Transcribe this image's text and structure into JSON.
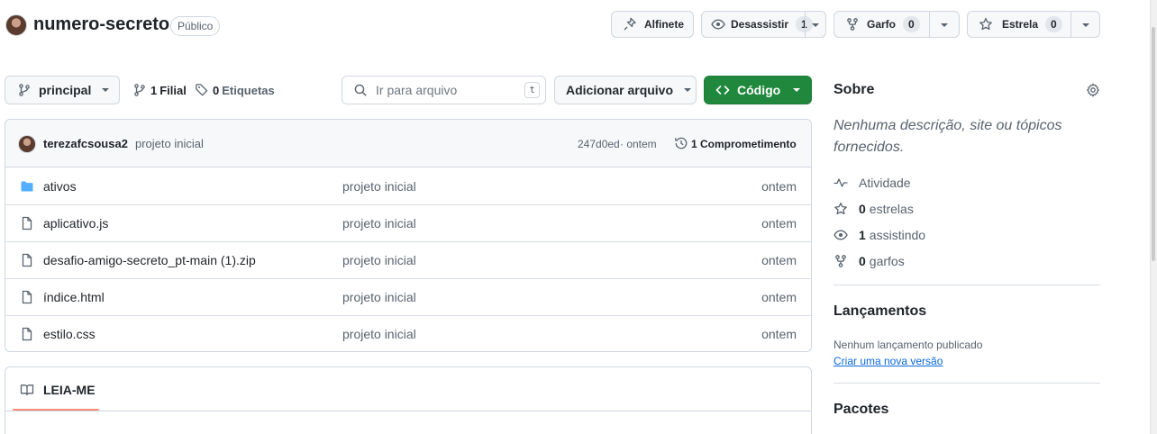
{
  "repo": {
    "name": "numero-secreto",
    "visibility": "Público"
  },
  "actions": {
    "pin": "Alfinete",
    "watch": "Desassistir",
    "watch_count": "1",
    "fork": "Garfo",
    "fork_count": "0",
    "star": "Estrela",
    "star_count": "0"
  },
  "toolbar": {
    "branch": "principal",
    "branches_count": "1",
    "branches_label": "Filial",
    "tags_count": "0",
    "tags_label": "Etiquetas",
    "search_placeholder": "Ir para arquivo",
    "search_shortcut": "t",
    "add_file": "Adicionar arquivo",
    "code": "Código"
  },
  "commit": {
    "author": "terezafcsousa2",
    "message": "projeto inicial",
    "hash": "247d0ed",
    "time": "· ontem",
    "count_label": "1 Comprometimento"
  },
  "files": [
    {
      "name": "ativos",
      "type": "folder",
      "message": "projeto inicial",
      "date": "ontem"
    },
    {
      "name": "aplicativo.js",
      "type": "file",
      "message": "projeto inicial",
      "date": "ontem"
    },
    {
      "name": "desafio-amigo-secreto_pt-main (1).zip",
      "type": "file",
      "message": "projeto inicial",
      "date": "ontem"
    },
    {
      "name": "índice.html",
      "type": "file",
      "message": "projeto inicial",
      "date": "ontem"
    },
    {
      "name": "estilo.css",
      "type": "file",
      "message": "projeto inicial",
      "date": "ontem"
    }
  ],
  "readme": {
    "tab": "LEIA-ME"
  },
  "sidebar": {
    "about_title": "Sobre",
    "description": "Nenhuma descrição, site ou tópicos fornecidos.",
    "activity": "Atividade",
    "stars_count": "0",
    "stars_label": "estrelas",
    "watching_count": "1",
    "watching_label": "assistindo",
    "forks_count": "0",
    "forks_label": "garfos",
    "releases_title": "Lançamentos",
    "releases_empty": "Nenhum lançamento publicado",
    "releases_link": "Criar uma nova versão",
    "packages_title": "Pacotes"
  },
  "colors": {
    "accent_green": "#1f883d",
    "folder_blue": "#54aeff",
    "link_blue": "#0969da",
    "readme_underline": "#fd8c73"
  }
}
